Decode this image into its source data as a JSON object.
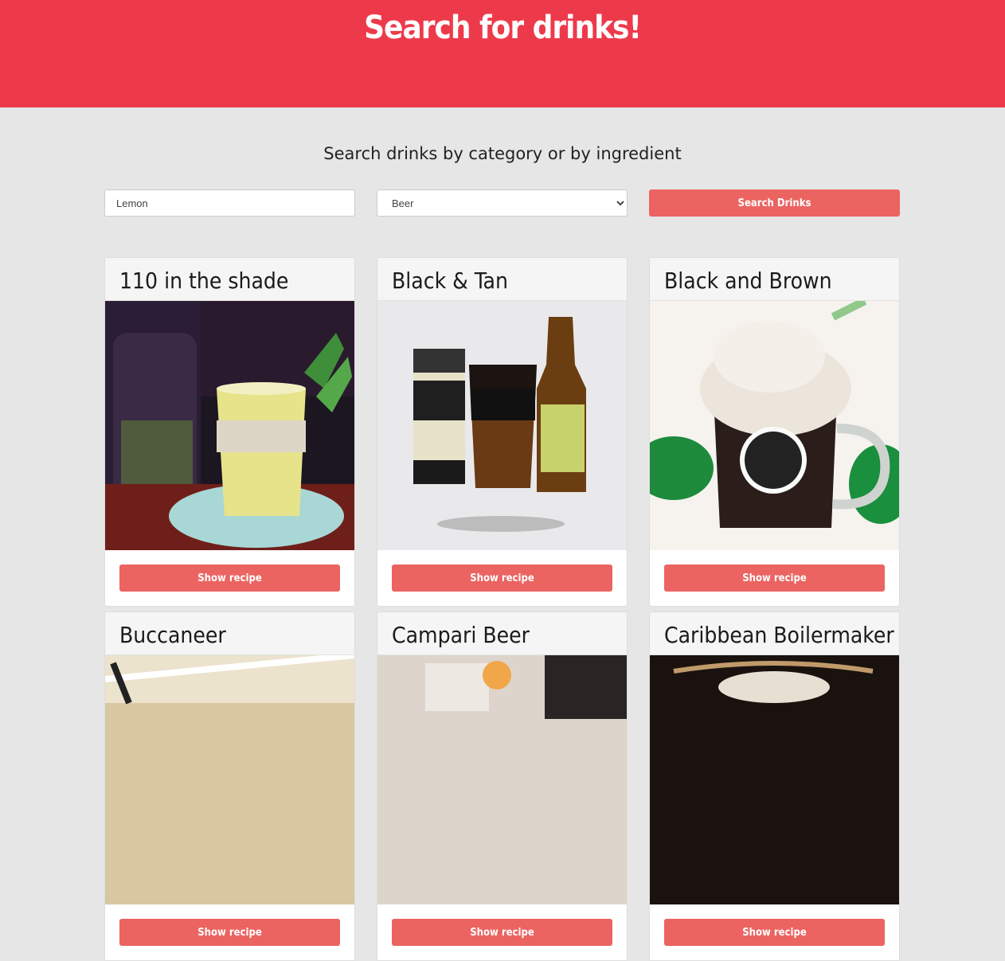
{
  "header": {
    "title": "Search for drinks!"
  },
  "subtitle": "Search drinks by category or by ingredient",
  "search": {
    "ingredient_value": "Lemon",
    "category_selected": "Beer",
    "button_label": "Search Drinks"
  },
  "drinks": [
    {
      "name": "110 in the shade",
      "button_label": "Show recipe"
    },
    {
      "name": "Black & Tan",
      "button_label": "Show recipe"
    },
    {
      "name": "Black and Brown",
      "button_label": "Show recipe"
    },
    {
      "name": "Buccaneer",
      "button_label": "Show recipe"
    },
    {
      "name": "Campari Beer",
      "button_label": "Show recipe"
    },
    {
      "name": "Caribbean Boilermaker",
      "button_label": "Show recipe"
    }
  ],
  "colors": {
    "header_bg": "#ed3a4b",
    "accent_button": "#eb6462",
    "page_bg": "#e6e6e6"
  }
}
